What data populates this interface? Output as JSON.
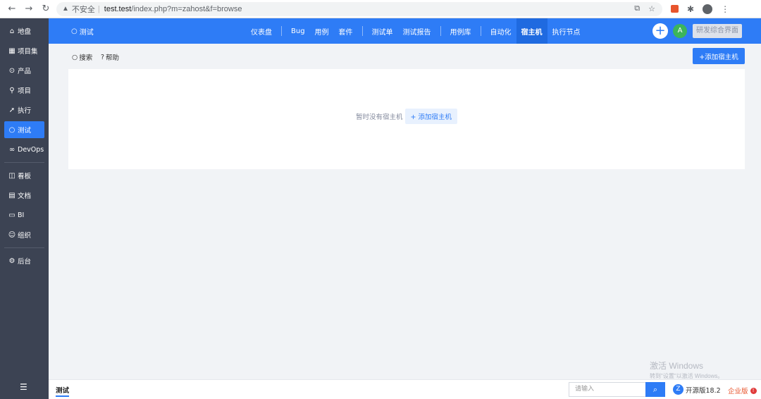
{
  "browser": {
    "insecure_label": "不安全",
    "url_host": "test.test",
    "url_path": "/index.php?m=zahost&f=browse"
  },
  "sidebar": {
    "items": [
      {
        "label": "地盘",
        "icon": "home-icon"
      },
      {
        "label": "项目集",
        "icon": "grid-icon"
      },
      {
        "label": "产品",
        "icon": "location-icon"
      },
      {
        "label": "项目",
        "icon": "rocket-icon"
      },
      {
        "label": "执行",
        "icon": "run-icon"
      },
      {
        "label": "测试",
        "icon": "search-icon",
        "active": true
      },
      {
        "label": "DevOps",
        "icon": "infinity-icon"
      },
      {
        "label": "看板",
        "icon": "kanban-icon"
      },
      {
        "label": "文档",
        "icon": "doc-icon"
      },
      {
        "label": "BI",
        "icon": "chart-icon"
      },
      {
        "label": "组织",
        "icon": "people-icon"
      },
      {
        "label": "后台",
        "icon": "gear-icon"
      }
    ]
  },
  "topnav": {
    "current": "测试",
    "menu": [
      "仪表盘",
      "Bug",
      "用例",
      "套件",
      "测试单",
      "测试报告",
      "用例库",
      "自动化",
      "宿主机",
      "执行节点"
    ],
    "active": "宿主机",
    "avatar": "A",
    "ui_button": "研发综合界面"
  },
  "toolbar": {
    "search": "搜索",
    "help": "帮助",
    "add_button": "+添加宿主机"
  },
  "empty": {
    "message": "暂时没有宿主机",
    "add_link": "+ 添加宿主机"
  },
  "watermark": {
    "line1": "激活 Windows",
    "line2": "转到\"设置\"以激活 Windows。"
  },
  "footer": {
    "crumb": "测试",
    "search_placeholder": "请输入",
    "version": "开源版18.2",
    "enterprise": "企业版"
  },
  "colors": {
    "primary": "#2e7cf6",
    "sidebar": "#3c4353"
  }
}
